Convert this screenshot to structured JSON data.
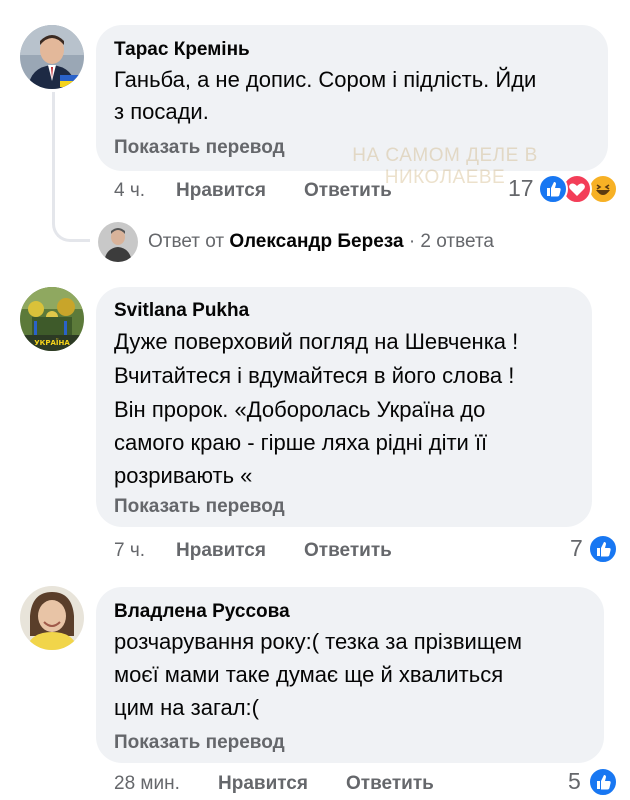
{
  "comments": [
    {
      "author": "Тарас Кремінь",
      "lines": [
        "Ганьба, а не допис. Сором і підлість. Йди",
        "з посади."
      ],
      "translate_label": "Показать перевод",
      "time": "4 ч.",
      "like_label": "Нравится",
      "reply_label": "Ответить",
      "reaction_count": "17",
      "reactions": [
        "like-icon",
        "love-icon",
        "haha-icon"
      ]
    },
    {
      "author": "Svitlana Pukha",
      "lines": [
        "Дуже поверховий погляд на Шевченка !",
        "Вчитайтеся і вдумайтеся в його слова !",
        "Він пророк. «Доборолась Україна до",
        "самого краю - гірше ляха рідні діти її",
        "розривають  «"
      ],
      "translate_label": "Показать перевод",
      "time": "7 ч.",
      "like_label": "Нравится",
      "reply_label": "Ответить",
      "reaction_count": "7",
      "reactions": [
        "like-icon"
      ]
    },
    {
      "author": "Владлена Руссова",
      "lines": [
        "розчарування року:( тезка за прізвищем",
        "моєї мами таке думає ще й хвалиться",
        "цим на загал:("
      ],
      "translate_label": "Показать перевод",
      "time": "28 мин.",
      "like_label": "Нравится",
      "reply_label": "Ответить",
      "reaction_count": "5",
      "reactions": [
        "like-icon"
      ]
    }
  ],
  "reply_summary": {
    "prefix": "Ответ от",
    "name": "Олександр Береза",
    "suffix": "· 2 ответа"
  },
  "avatar2_caption": "УКРАЇНА",
  "watermark": [
    "НА САМОМ ДЕЛЕ В",
    "НИКОЛАЕВЕ"
  ],
  "colors": {
    "bubble": "#f0f2f5",
    "secondary_text": "#65676b",
    "like_blue": "#1877f2",
    "love_red": "#f33e58",
    "haha_yellow": "#f7b125"
  }
}
